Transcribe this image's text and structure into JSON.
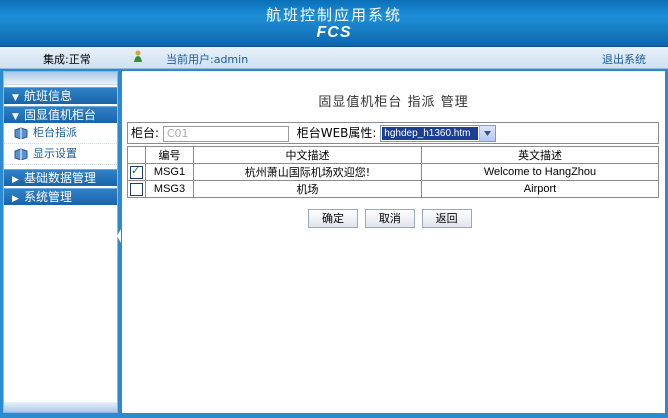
{
  "header": {
    "title": "航班控制应用系统",
    "logo": "FCS"
  },
  "status": {
    "integration": "集成:正常",
    "current_user": "当前用户:admin",
    "logout": "退出系统"
  },
  "sidebar": {
    "sections": [
      {
        "label": "航班信息",
        "arrow": "▼"
      },
      {
        "label": "固显值机柜台",
        "arrow": "▼"
      }
    ],
    "sub_items": [
      {
        "label": "柜台指派"
      },
      {
        "label": "显示设置"
      }
    ],
    "sections_after": [
      {
        "label": "基础数据管理",
        "arrow": "▶"
      },
      {
        "label": "系统管理",
        "arrow": "▶"
      }
    ]
  },
  "main": {
    "title": "固显值机柜台 指派  管理",
    "counter_label": "柜台:",
    "counter_value": "C01",
    "web_attr_label": "柜台WEB属性:",
    "web_attr_value": "hghdep_h1360.htm",
    "columns": [
      "编号",
      "中文描述",
      "英文描述"
    ],
    "rows": [
      {
        "checked": true,
        "id": "MSG1",
        "cn": "杭州萧山国际机场欢迎您!",
        "en": "Welcome to HangZhou"
      },
      {
        "checked": false,
        "id": "MSG3",
        "cn": "机场",
        "en": "Airport"
      }
    ],
    "buttons": {
      "confirm": "确定",
      "cancel": "取消",
      "back": "返回"
    }
  },
  "colors": {
    "header_blue": "#1e8fd8",
    "frame_blue": "#2b8ad0",
    "nav_blue": "#1a63a8",
    "selection": "#1c3f94"
  }
}
